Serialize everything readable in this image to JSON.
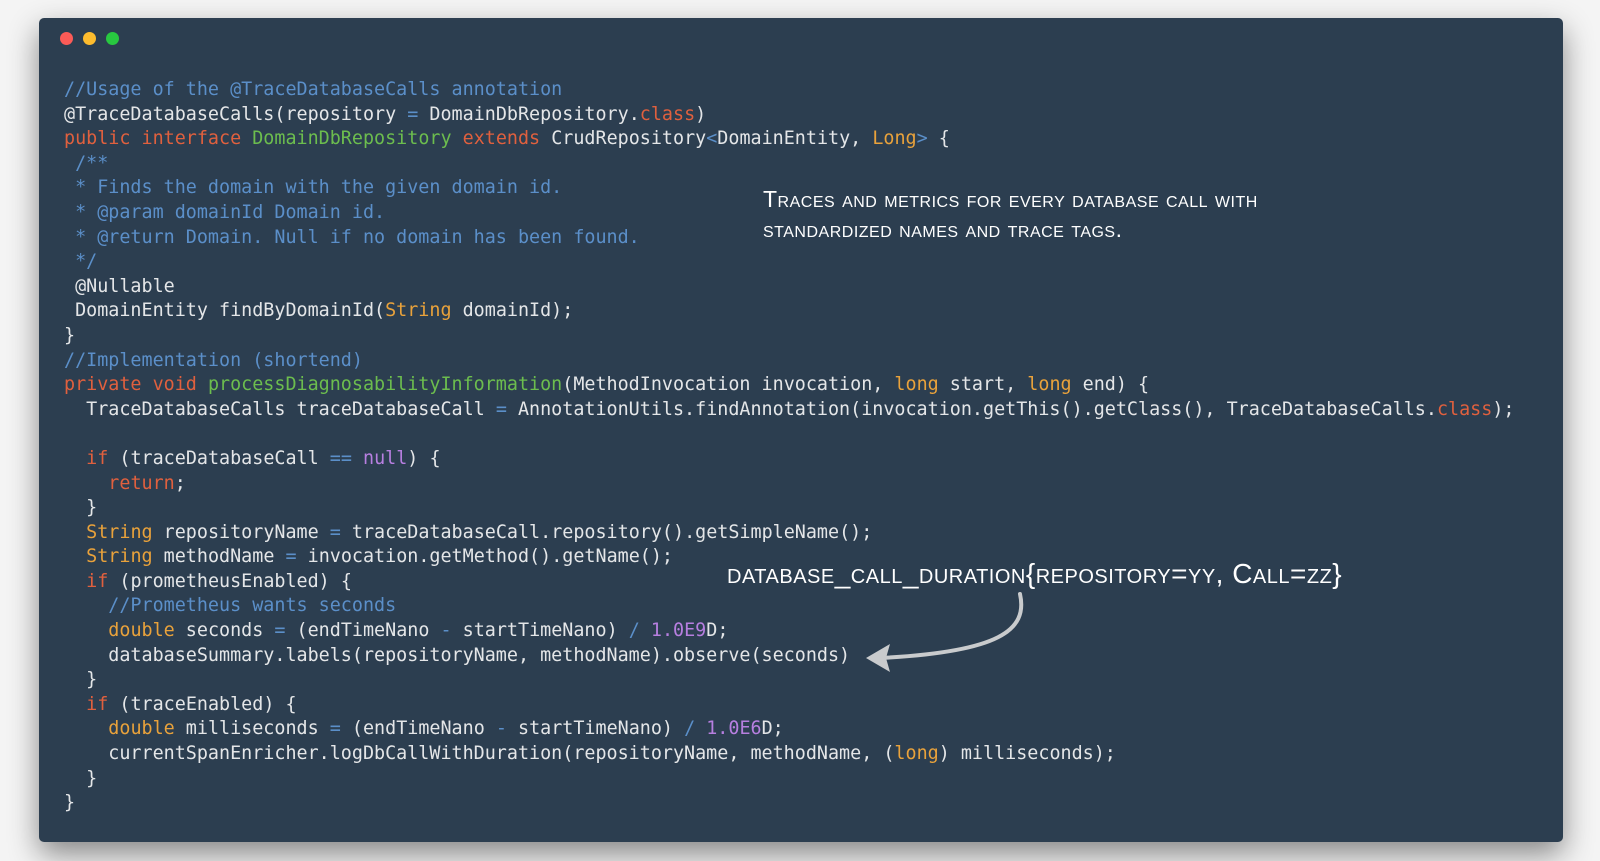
{
  "window": {
    "controls": [
      {
        "name": "close",
        "color": "#fc5b57"
      },
      {
        "name": "minimize",
        "color": "#fdbc2e"
      },
      {
        "name": "maximize",
        "color": "#28c840"
      }
    ],
    "background": "#2c3e50"
  },
  "annotations": {
    "traces_note": "Traces and metrics for every database call with\nstandardized names and trace tags.",
    "metric_note": "database_call_duration{repository=yy, Call=zz}"
  },
  "code_lines": [
    [
      [
        "//Usage of the @TraceDatabaseCalls annotation",
        "comment"
      ]
    ],
    [
      [
        "@TraceDatabaseCalls(repository ",
        ""
      ],
      [
        "=",
        "op"
      ],
      [
        " DomainDbRepository.",
        ""
      ],
      [
        "class",
        "kw"
      ],
      [
        ")",
        ""
      ]
    ],
    [
      [
        "public interface ",
        "kw"
      ],
      [
        "DomainDbRepository",
        "name"
      ],
      [
        " extends ",
        "kw"
      ],
      [
        "CrudRepository",
        ""
      ],
      [
        "<",
        "op"
      ],
      [
        "DomainEntity, ",
        ""
      ],
      [
        "Long",
        "type"
      ],
      [
        ">",
        "op"
      ],
      [
        " {",
        ""
      ]
    ],
    [
      [
        " /**",
        "comment"
      ]
    ],
    [
      [
        " * Finds the domain with the given domain id.",
        "comment"
      ]
    ],
    [
      [
        " * @param domainId Domain id.",
        "comment"
      ]
    ],
    [
      [
        " * @return Domain. Null if no domain has been found.",
        "comment"
      ]
    ],
    [
      [
        " */",
        "comment"
      ]
    ],
    [
      [
        " @Nullable",
        ""
      ]
    ],
    [
      [
        " DomainEntity findByDomainId(",
        ""
      ],
      [
        "String",
        "type"
      ],
      [
        " domainId);",
        ""
      ]
    ],
    [
      [
        "}",
        ""
      ]
    ],
    [
      [
        "//Implementation (shortend)",
        "comment"
      ]
    ],
    [
      [
        "private void ",
        "kw"
      ],
      [
        "processDiagnosabilityInformation",
        "name"
      ],
      [
        "(MethodInvocation invocation, ",
        ""
      ],
      [
        "long",
        "type"
      ],
      [
        " start, ",
        ""
      ],
      [
        "long",
        "type"
      ],
      [
        " end) {",
        ""
      ]
    ],
    [
      [
        "  TraceDatabaseCalls traceDatabaseCall ",
        ""
      ],
      [
        "=",
        "op"
      ],
      [
        " AnnotationUtils.findAnnotation(invocation.getThis().getClass(), TraceDatabaseCalls.",
        ""
      ],
      [
        "class",
        "kw"
      ],
      [
        ");",
        ""
      ]
    ],
    [
      [
        "",
        ""
      ]
    ],
    [
      [
        "  ",
        ""
      ],
      [
        "if",
        "kw"
      ],
      [
        " (traceDatabaseCall ",
        ""
      ],
      [
        "==",
        "op"
      ],
      [
        " ",
        ""
      ],
      [
        "null",
        "num"
      ],
      [
        ") {",
        ""
      ]
    ],
    [
      [
        "    ",
        ""
      ],
      [
        "return",
        "kw"
      ],
      [
        ";",
        ""
      ]
    ],
    [
      [
        "  }",
        ""
      ]
    ],
    [
      [
        "  ",
        ""
      ],
      [
        "String",
        "type"
      ],
      [
        " repositoryName ",
        ""
      ],
      [
        "=",
        "op"
      ],
      [
        " traceDatabaseCall.repository().getSimpleName();",
        ""
      ]
    ],
    [
      [
        "  ",
        ""
      ],
      [
        "String",
        "type"
      ],
      [
        " methodName ",
        ""
      ],
      [
        "=",
        "op"
      ],
      [
        " invocation.getMethod().getName();",
        ""
      ]
    ],
    [
      [
        "  ",
        ""
      ],
      [
        "if",
        "kw"
      ],
      [
        " (prometheusEnabled) {",
        ""
      ]
    ],
    [
      [
        "    //Prometheus wants seconds",
        "comment"
      ]
    ],
    [
      [
        "    ",
        ""
      ],
      [
        "double",
        "type"
      ],
      [
        " seconds ",
        ""
      ],
      [
        "=",
        "op"
      ],
      [
        " (endTimeNano ",
        ""
      ],
      [
        "-",
        "op"
      ],
      [
        " startTimeNano) ",
        ""
      ],
      [
        "/",
        "op"
      ],
      [
        " ",
        ""
      ],
      [
        "1.0E9",
        "num"
      ],
      [
        "D;",
        ""
      ]
    ],
    [
      [
        "    databaseSummary.labels(repositoryName, methodName).observe(seconds)",
        ""
      ]
    ],
    [
      [
        "  }",
        ""
      ]
    ],
    [
      [
        "  ",
        ""
      ],
      [
        "if",
        "kw"
      ],
      [
        " (traceEnabled) {",
        ""
      ]
    ],
    [
      [
        "    ",
        ""
      ],
      [
        "double",
        "type"
      ],
      [
        " milliseconds ",
        ""
      ],
      [
        "=",
        "op"
      ],
      [
        " (endTimeNano ",
        ""
      ],
      [
        "-",
        "op"
      ],
      [
        " startTimeNano) ",
        ""
      ],
      [
        "/",
        "op"
      ],
      [
        " ",
        ""
      ],
      [
        "1.0E6",
        "num"
      ],
      [
        "D;",
        ""
      ]
    ],
    [
      [
        "    currentSpanEnricher.logDbCallWithDuration(repositoryName, methodName, (",
        ""
      ],
      [
        "long",
        "type"
      ],
      [
        ") milliseconds);",
        ""
      ]
    ],
    [
      [
        "  }",
        ""
      ]
    ],
    [
      [
        "}",
        ""
      ]
    ]
  ]
}
